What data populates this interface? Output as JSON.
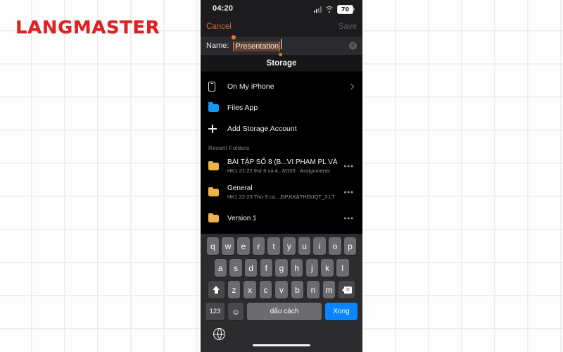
{
  "brand": {
    "name": "LANGMASTER",
    "color": "#e02020"
  },
  "phone": {
    "status": {
      "time": "04:20",
      "signal_icon": "cellular-bars-icon",
      "wifi_icon": "wifi-icon",
      "battery_level": "70"
    },
    "navbar": {
      "cancel_label": "Cancel",
      "save_label": "Save",
      "cancel_color": "#cd6b3a",
      "save_color": "#5d5d5f"
    },
    "name_field": {
      "label": "Name:",
      "value": "Presentation",
      "placeholder": "Name",
      "selection_color": "#e2703c",
      "clear_icon": "✕"
    },
    "section_title": "Storage",
    "storage_items": [
      {
        "label": "On My iPhone",
        "icon": "iphone-icon",
        "accessory": "chevron-right-icon"
      },
      {
        "label": "Files App",
        "icon": "folder-icon",
        "icon_color": "#1199f5",
        "accessory": ""
      },
      {
        "label": "Add Storage Account",
        "icon": "plus-icon",
        "accessory": ""
      }
    ],
    "recent_header": "Recent Folders",
    "recent_folders": [
      {
        "title": "BÀI TẬP SỐ 8 (B...VI PHẠM PL VÀ",
        "subtitle": "HK1 21-22 thứ 6 ca 4...M105 · Assignments",
        "icon": "folder-icon",
        "icon_color": "#edb34a",
        "more_label": "•••"
      },
      {
        "title": "General",
        "subtitle": "HK1 22-23 Thứ 5 ca...,ĐP,KK&THĐUQT_3.LT",
        "icon": "folder-icon",
        "icon_color": "#edb34a",
        "more_label": "•••"
      },
      {
        "title": "Version 1",
        "subtitle": "",
        "icon": "folder-icon",
        "icon_color": "#edb34a",
        "more_label": "•••"
      }
    ],
    "keyboard": {
      "row1": [
        "q",
        "w",
        "e",
        "r",
        "t",
        "y",
        "u",
        "i",
        "o",
        "p"
      ],
      "row2": [
        "a",
        "s",
        "d",
        "f",
        "g",
        "h",
        "j",
        "k",
        "l"
      ],
      "row3": [
        "z",
        "x",
        "c",
        "v",
        "b",
        "n",
        "m"
      ],
      "shift_icon": "shift-icon",
      "backspace_icon": "backspace-icon",
      "numbers_label": "123",
      "emoji_label": "☺",
      "space_label": "dấu cách",
      "done_label": "Xong",
      "done_color": "#0a84ff",
      "globe_icon": "globe-icon"
    }
  }
}
